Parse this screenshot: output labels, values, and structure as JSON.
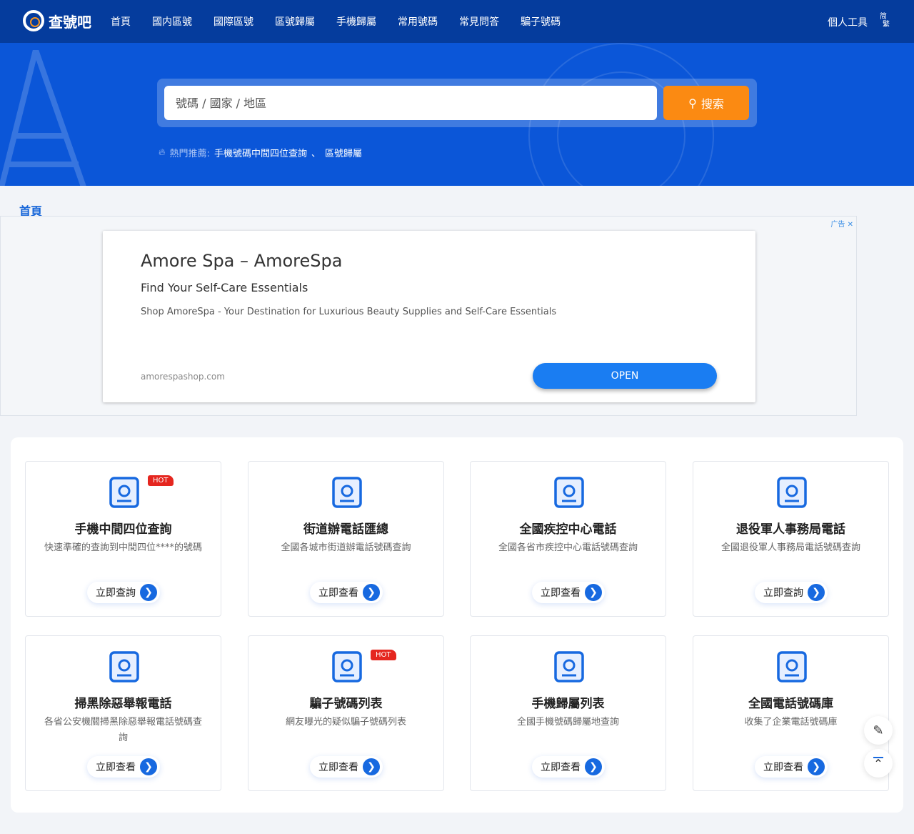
{
  "header": {
    "brand": "查號吧",
    "nav": [
      "首頁",
      "國内區號",
      "國際區號",
      "區號歸屬",
      "手機歸屬",
      "常用號碼",
      "常見問答",
      "騙子號碼"
    ],
    "tools": "個人工具",
    "lang_top": "简",
    "lang_bottom": "繁"
  },
  "search": {
    "placeholder": "號碼 / 國家 / 地區",
    "button": "搜索",
    "hot_label": "熱門推薦:",
    "hot_links": [
      "手機號碼中間四位查詢",
      "區號歸屬"
    ],
    "separator": "、"
  },
  "breadcrumb": "首頁",
  "ad": {
    "tag": "广告",
    "title": "Amore Spa – AmoreSpa",
    "subtitle": "Find Your Self-Care Essentials",
    "desc": "Shop AmoreSpa - Your Destination for Luxurious Beauty Supplies and Self-Care Essentials",
    "url": "amorespashop.com",
    "open": "OPEN"
  },
  "cards": [
    {
      "title": "手機中間四位查詢",
      "desc": "快速準確的查詢到中間四位****的號碼",
      "btn": "立即查詢",
      "hot": "HOT",
      "icon": "search-document-icon"
    },
    {
      "title": "街道辦電話匯總",
      "desc": "全國各城市街道辦電話號碼查詢",
      "btn": "立即查看",
      "icon": "building-location-icon"
    },
    {
      "title": "全國疾控中心電話",
      "desc": "全國各省市疾控中心電話號碼查詢",
      "btn": "立即查看",
      "icon": "cdc-icon"
    },
    {
      "title": "退役軍人事務局電話",
      "desc": "全國退役軍人事務局電話號碼查詢",
      "btn": "立即查詢",
      "icon": "star-badge-icon"
    },
    {
      "title": "掃黑除惡舉報電話",
      "desc": "各省公安機關掃黑除惡舉報電話號碼查詢",
      "btn": "立即查看",
      "icon": "police-icon"
    },
    {
      "title": "騙子號碼列表",
      "desc": "網友曝光的疑似騙子號碼列表",
      "btn": "立即查看",
      "hot": "HOT",
      "icon": "phone-warning-icon"
    },
    {
      "title": "手機歸屬列表",
      "desc": "全國手機號碼歸屬地查詢",
      "btn": "立即查看",
      "icon": "location-card-icon"
    },
    {
      "title": "全國電話號碼庫",
      "desc": "收集了企業電話號碼庫",
      "btn": "立即查看",
      "icon": "phone-book-icon"
    }
  ],
  "colors": {
    "header": "#053c9d",
    "hero": "#0b56d8",
    "accent": "#1769e0",
    "search_button": "#fb8a12",
    "hot": "#e5261f"
  }
}
